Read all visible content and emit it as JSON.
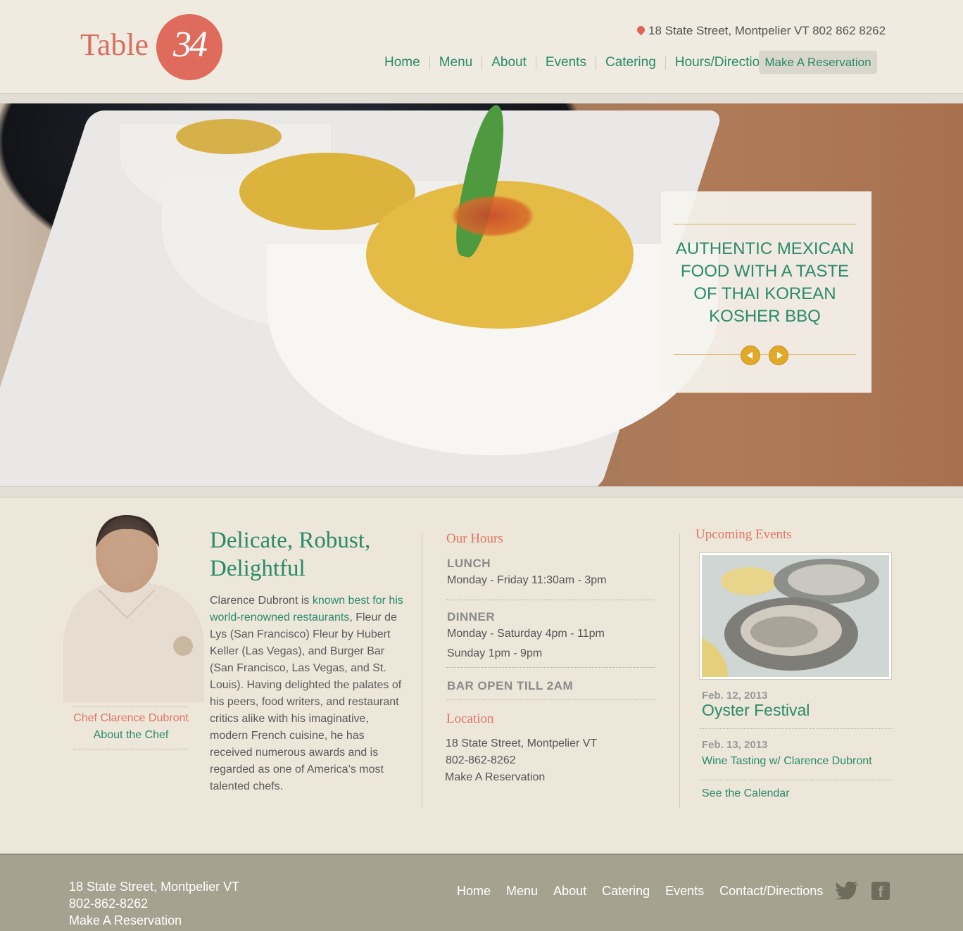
{
  "header": {
    "logo_word": "Table",
    "logo_number": "34",
    "address": "18 State Street,  Montpelier VT 802 862 8262",
    "nav": [
      "Home",
      "Menu",
      "About",
      "Events",
      "Catering",
      "Hours/Directions"
    ],
    "reserve_button": "Make A Reservation"
  },
  "hero": {
    "caption": "Authentic Mexican Food with a taste of Thai Korean Kosher BBQ"
  },
  "chef": {
    "name": "Chef Clarence Dubront",
    "about_link": "About the Chef"
  },
  "intro": {
    "title": "Delicate, Robust, Delightful",
    "body_start": "Clarence Dubront is ",
    "body_link": "known best for his world-renowned restaurants",
    "body_end": ", Fleur de Lys (San Francisco) Fleur by Hubert Keller (Las Vegas), and Burger Bar (San Francisco, Las Vegas, and St. Louis). Having delighted the palates of his peers, food writers, and restaurant critics alike with his imaginative, modern French cuisine, he has received numerous awards and is regarded as one of America’s most talented chefs."
  },
  "hours": {
    "title": "Our Hours",
    "lunch_label": "LUNCH",
    "lunch_line": "Monday - Friday 11:30am - 3pm",
    "dinner_label": "DINNER",
    "dinner_line1": "Monday - Saturday 4pm - 11pm",
    "dinner_line2": "Sunday 1pm - 9pm",
    "bar_label": "BAR OPEN TILL 2AM"
  },
  "location": {
    "title": "Location",
    "address": "18 State Street, Montpelier VT",
    "phone": "802-862-8262",
    "reserve_link": "Make A Reservation"
  },
  "events": {
    "title": "Upcoming Events",
    "items": [
      {
        "date": "Feb. 12, 2013",
        "name": "Oyster Festival"
      },
      {
        "date": "Feb. 13, 2013",
        "name": "Wine Tasting w/ Clarence Dubront"
      }
    ],
    "calendar_link": "See the Calendar"
  },
  "footer": {
    "address": "18 State Street, Montpelier VT",
    "phone": "802-862-8262",
    "reserve_link": "Make A Reservation",
    "nav": [
      "Home",
      "Menu",
      "About",
      "Catering",
      "Events",
      "Contact/Directions"
    ]
  },
  "colors": {
    "accent_green": "#2a8a6a",
    "accent_coral": "#df6b5c",
    "accent_gold": "#e1a928",
    "footer_bg": "#a5a38f"
  }
}
